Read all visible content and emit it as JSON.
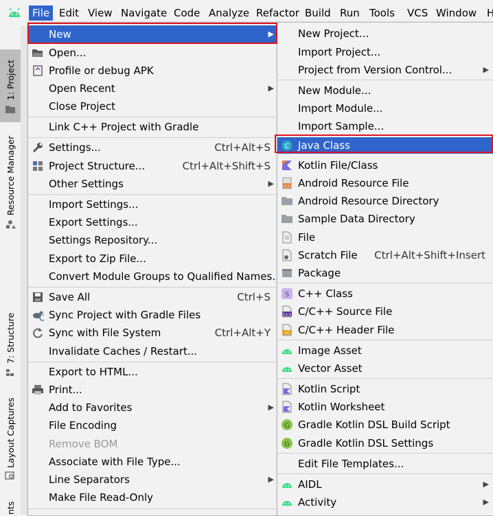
{
  "menubar": {
    "items": [
      {
        "label": "File",
        "active": true
      },
      {
        "label": "Edit"
      },
      {
        "label": "View"
      },
      {
        "label": "Navigate"
      },
      {
        "label": "Code"
      },
      {
        "label": "Analyze"
      },
      {
        "label": "Refactor"
      },
      {
        "label": "Build"
      },
      {
        "label": "Run"
      },
      {
        "label": "Tools"
      },
      {
        "label": "VCS"
      },
      {
        "label": "Window"
      },
      {
        "label": "H"
      }
    ]
  },
  "left_strip": {
    "project": "1: Project",
    "resource_manager": "Resource Manager",
    "structure": "7: Structure",
    "layout_captures": "Layout Captures",
    "bottom": "nts"
  },
  "file_menu": {
    "new": "New",
    "open": "Open...",
    "profile_debug": "Profile or debug APK",
    "open_recent": "Open Recent",
    "close_project": "Close Project",
    "link_cpp": "Link C++ Project with Gradle",
    "settings": "Settings...",
    "settings_sc": "Ctrl+Alt+S",
    "project_structure": "Project Structure...",
    "project_structure_sc": "Ctrl+Alt+Shift+S",
    "other_settings": "Other Settings",
    "import_settings": "Import Settings...",
    "export_settings": "Export Settings...",
    "settings_repo": "Settings Repository...",
    "export_zip": "Export to Zip File...",
    "convert_module": "Convert Module Groups to Qualified Names...",
    "save_all": "Save All",
    "save_all_sc": "Ctrl+S",
    "sync_gradle": "Sync Project with Gradle Files",
    "sync_fs": "Sync with File System",
    "sync_fs_sc": "Ctrl+Alt+Y",
    "invalidate": "Invalidate Caches / Restart...",
    "export_html": "Export to HTML...",
    "print": "Print...",
    "favorites": "Add to Favorites",
    "file_encoding": "File Encoding",
    "remove_bom": "Remove BOM",
    "associate": "Associate with File Type...",
    "line_sep": "Line Separators",
    "read_only": "Make File Read-Only"
  },
  "new_menu": {
    "new_project": "New Project...",
    "import_project": "Import Project...",
    "project_vcs": "Project from Version Control...",
    "new_module": "New Module...",
    "import_module": "Import Module...",
    "import_sample": "Import Sample...",
    "java_class": "Java Class",
    "kotlin_file": "Kotlin File/Class",
    "android_resource_file": "Android Resource File",
    "android_resource_dir": "Android Resource Directory",
    "sample_data_dir": "Sample Data Directory",
    "file": "File",
    "scratch_file": "Scratch File",
    "scratch_sc": "Ctrl+Alt+Shift+Insert",
    "package": "Package",
    "cpp_class": "C++ Class",
    "cpp_source": "C/C++ Source File",
    "cpp_header": "C/C++ Header File",
    "image_asset": "Image Asset",
    "vector_asset": "Vector Asset",
    "kotlin_script": "Kotlin Script",
    "kotlin_worksheet": "Kotlin Worksheet",
    "gradle_build": "Gradle Kotlin DSL Build Script",
    "gradle_settings": "Gradle Kotlin DSL Settings",
    "edit_templates": "Edit File Templates...",
    "aidl": "AIDL",
    "activity": "Activity"
  },
  "colors": {
    "highlight": "#2f65ca",
    "annotation_red": "#e0141e",
    "android_green": "#3ddc84",
    "kotlin_orange": "#e77f3c",
    "folder_gray": "#9aa0a6"
  }
}
